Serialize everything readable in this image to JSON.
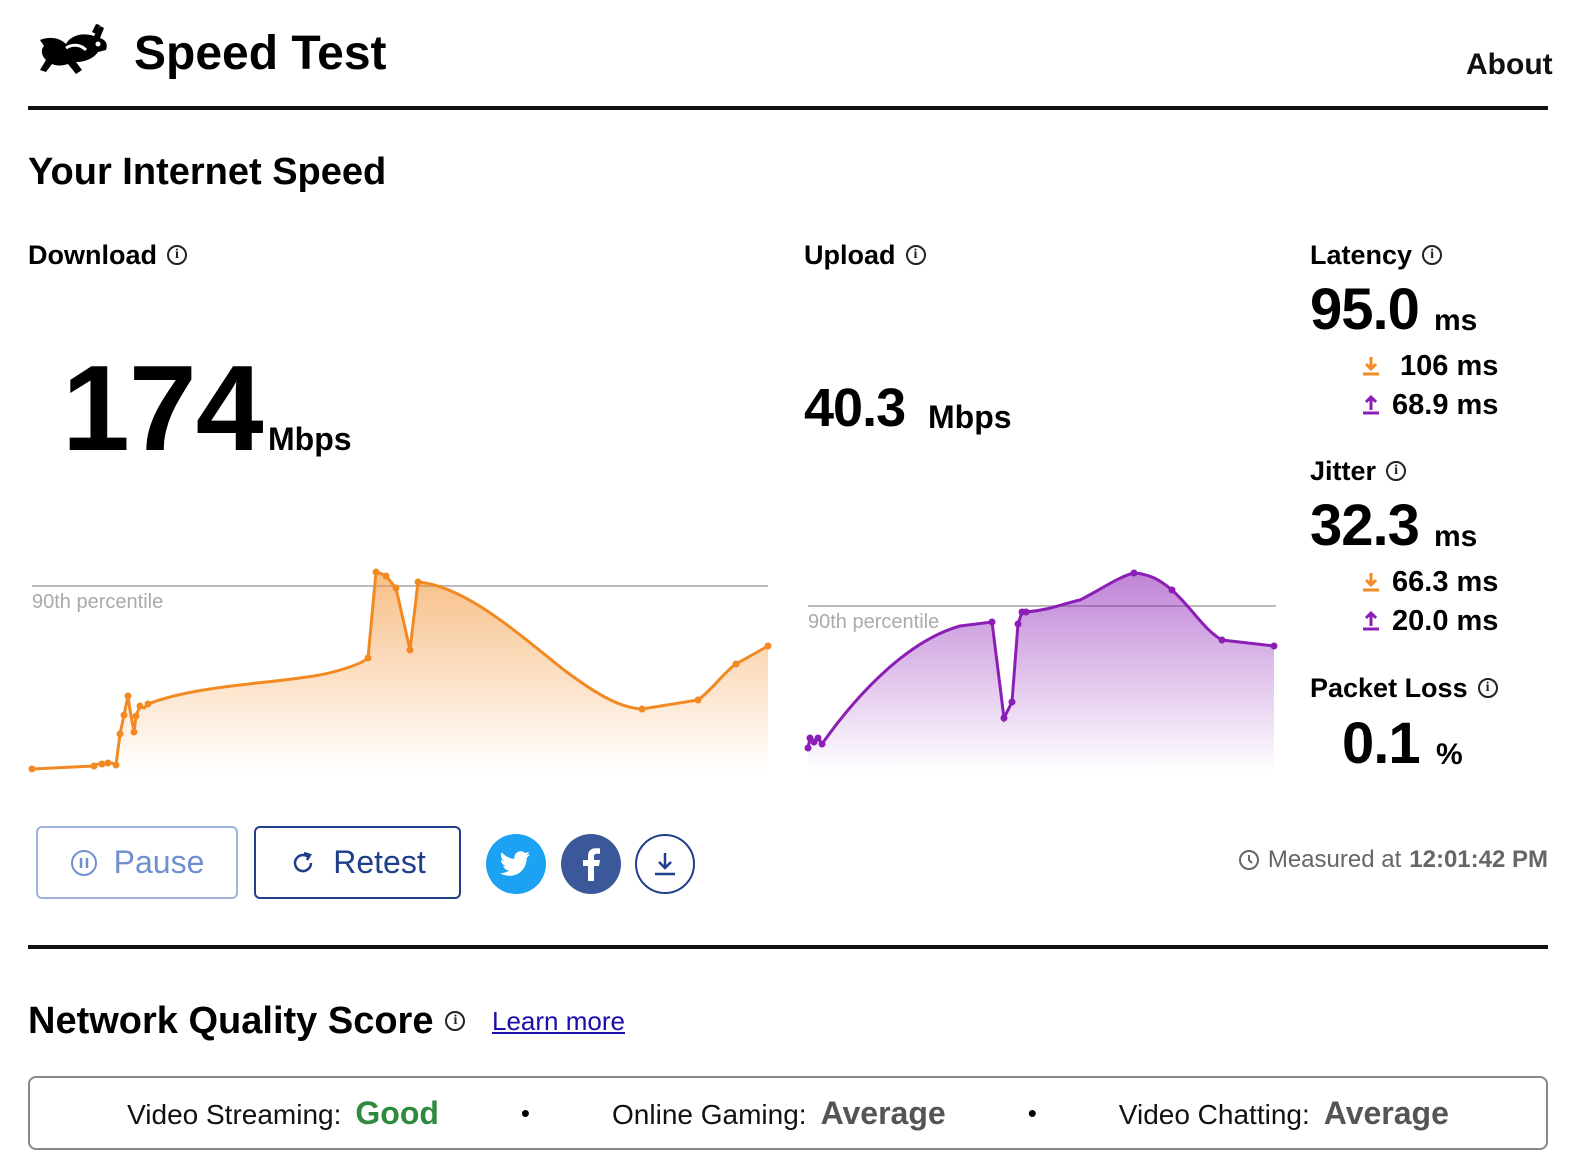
{
  "header": {
    "title": "Speed Test",
    "about_label": "About"
  },
  "section_title": "Your Internet Speed",
  "download": {
    "label": "Download",
    "value": "174",
    "unit": "Mbps",
    "percentile_label": "90th percentile",
    "color": "#f28a24"
  },
  "upload": {
    "label": "Upload",
    "value": "40.3",
    "unit": "Mbps",
    "percentile_label": "90th percentile",
    "color": "#8b1fb5"
  },
  "latency": {
    "label": "Latency",
    "value": "95.0",
    "unit": "ms",
    "down_value": "106 ms",
    "up_value": "68.9 ms"
  },
  "jitter": {
    "label": "Jitter",
    "value": "32.3",
    "unit": "ms",
    "down_value": "66.3 ms",
    "up_value": "20.0 ms"
  },
  "packet_loss": {
    "label": "Packet Loss",
    "value": "0.1",
    "unit": "%"
  },
  "actions": {
    "pause_label": "Pause",
    "retest_label": "Retest",
    "twitter_icon": "twitter-icon",
    "facebook_icon": "facebook-icon",
    "download_icon": "download-icon"
  },
  "measured": {
    "prefix": "Measured at",
    "time": "12:01:42 PM"
  },
  "network_quality": {
    "title": "Network Quality Score",
    "learn_more": "Learn more",
    "items": [
      {
        "label": "Video Streaming:",
        "value": "Good",
        "color": "#2e8b3e"
      },
      {
        "label": "Online Gaming:",
        "value": "Average",
        "color": "#555555"
      },
      {
        "label": "Video Chatting:",
        "value": "Average",
        "color": "#555555"
      }
    ],
    "separator": "•"
  },
  "colors": {
    "accent_blue": "#1f3f8a",
    "twitter_blue": "#1da1f2",
    "facebook_blue": "#3b5998"
  }
}
